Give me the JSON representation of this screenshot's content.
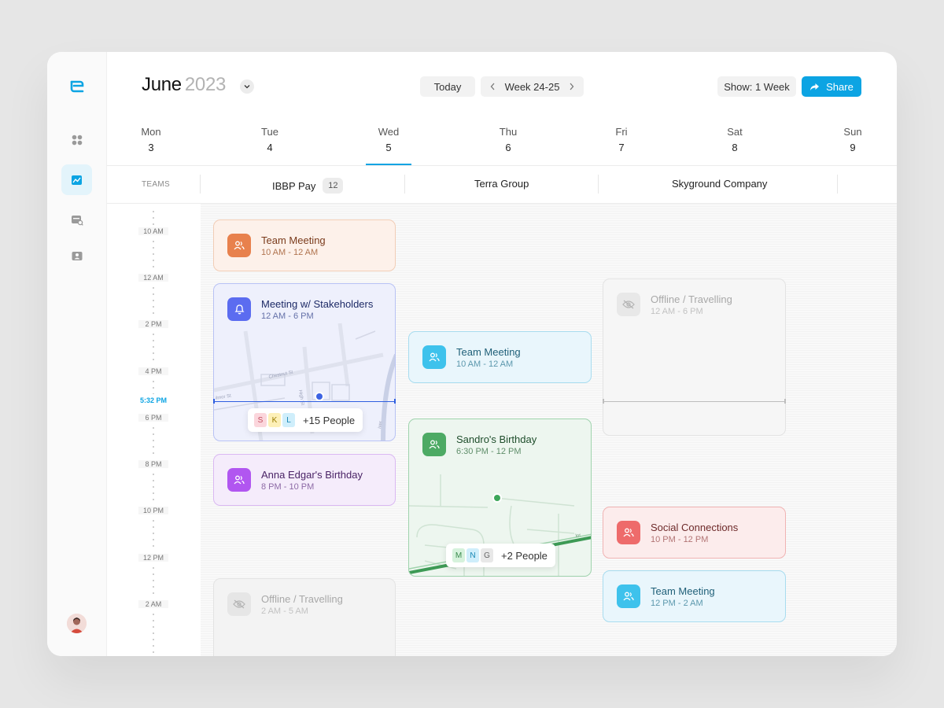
{
  "header": {
    "month": "June",
    "year": "2023",
    "today_label": "Today",
    "week_label": "Week 24-25",
    "show_label": "Show: 1 Week",
    "share_label": "Share"
  },
  "days": [
    {
      "name": "Mon",
      "date": "3"
    },
    {
      "name": "Tue",
      "date": "4"
    },
    {
      "name": "Wed",
      "date": "5"
    },
    {
      "name": "Thu",
      "date": "6"
    },
    {
      "name": "Fri",
      "date": "7"
    },
    {
      "name": "Sat",
      "date": "8"
    },
    {
      "name": "Sun",
      "date": "9"
    }
  ],
  "selected_day": "Wed",
  "teams": {
    "label": "TEAMS",
    "items": [
      {
        "name": "IBBP Pay",
        "count": "12"
      },
      {
        "name": "Terra Group"
      },
      {
        "name": "Skyground Company"
      }
    ]
  },
  "times": [
    "10 AM",
    "12 AM",
    "2 PM",
    "4 PM",
    "6 PM",
    "8 PM",
    "10 PM",
    "12 PM",
    "2 AM"
  ],
  "current_time": "5:32 PM",
  "events": {
    "team_meeting_1": {
      "title": "Team Meeting",
      "time": "10 AM - 12 AM"
    },
    "stakeholders": {
      "title": "Meeting w/ Stakeholders",
      "time": "12 AM - 6 PM",
      "people_initials": [
        "S",
        "K",
        "L"
      ],
      "people_more": "+15 People",
      "map_labels": [
        "Chestnut St",
        "High St",
        "ilmor St",
        "iver"
      ]
    },
    "anna_birthday": {
      "title": "Anna Edgar's Birthday",
      "time": "8 PM - 10 PM"
    },
    "offline_1": {
      "title": "Offline / Travelling",
      "time": "2 AM - 5 AM"
    },
    "team_meeting_2": {
      "title": "Team Meeting",
      "time": "10 AM - 12 AM"
    },
    "sandro_birthday": {
      "title": "Sandro's Birthday",
      "time": "6:30  PM - 12 PM",
      "people_initials": [
        "M",
        "N",
        "G"
      ],
      "people_more": "+2 People",
      "map_labels": [
        "lor"
      ]
    },
    "offline_2": {
      "title": "Offline / Travelling",
      "time": "12 AM - 6 PM"
    },
    "social": {
      "title": "Social Connections",
      "time": "10 PM - 12 PM"
    },
    "team_meeting_3": {
      "title": "Team Meeting",
      "time": "12 PM - 2 AM"
    }
  },
  "colors": {
    "accent": "#0ca4e3",
    "orange": "#e8814d",
    "indigo": "#5b6cf0",
    "purple": "#b156f0",
    "cyan": "#3ec2ec",
    "green": "#4daa64",
    "red": "#ee6b6b",
    "gray": "#c8c8c8"
  }
}
